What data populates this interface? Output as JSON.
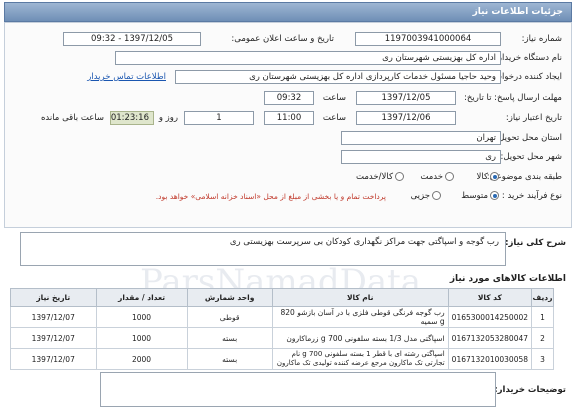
{
  "header": {
    "title": "جزئیات اطلاعات نیاز"
  },
  "form": {
    "need_number_label": "شماره نیاز:",
    "need_number": "1197003941000064",
    "announce_label": "تاریخ و ساعت اعلان عمومی:",
    "announce_value": "1397/12/05 - 09:32",
    "buyer_label": "نام دستگاه خریدار:",
    "buyer_value": "اداره کل بهزیستی شهرستان ری",
    "creator_label": "ایجاد کننده درخواست:",
    "creator_value": "وحید حاجیا مسئول خدمات کارپردازی اداره کل بهزیستی شهرستان ری",
    "contact_link": "اطلاعات تماس خریدار",
    "send_deadline_label": "مهلت ارسال پاسخ: تا تاریخ:",
    "send_date": "1397/12/05",
    "time_label": "ساعت",
    "send_time": "09:32",
    "validity_label": "تاریخ اعتبار نیاز:",
    "validity_date": "1397/12/06",
    "validity_time": "11:00",
    "days_value": "1",
    "days_label": "روز و",
    "remaining_time": "01:23:16",
    "remaining_label": "ساعت باقی مانده",
    "province_label": "استان محل تحویل:",
    "province_value": "تهران",
    "city_label": "شهر محل تحویل:",
    "city_value": "ری",
    "category_label": "طبقه بندی موضوعی:",
    "category_options": [
      "کالا",
      "خدمت",
      "کالا/خدمت"
    ],
    "purchase_label": "نوع فرآیند خرید :",
    "purchase_options": [
      "متوسط",
      "جزیی"
    ],
    "purchase_note": "پرداخت تمام و یا بخشی از مبلغ از محل «اسناد خزانه اسلامی» خواهد بود.",
    "general_desc_label": "شرح کلی نیاز:",
    "general_desc": "رب گوجه و اسپاگتی جهت مراکز نگهداری کودکان بی سرپرست بهزیستی ری"
  },
  "items_section": {
    "title": "اطلاعات کالاهای مورد نیاز",
    "columns": [
      "ردیف",
      "کد کالا",
      "نام کالا",
      "واحد شمارش",
      "تعداد / مقدار",
      "تاریخ نیاز"
    ],
    "rows": [
      {
        "row": "1",
        "code": "0165300014250002",
        "name": "رب گوجه فرنگی قوطی فلزی با در آسان بازشو 820 g سمیه",
        "unit": "قوطی",
        "qty": "1000",
        "date": "1397/12/07"
      },
      {
        "row": "2",
        "code": "0167132053280047",
        "name": "اسپاگتی مدل 1/3 بسته سلفونی 700 g زرماکارون",
        "unit": "بسته",
        "qty": "1000",
        "date": "1397/12/07"
      },
      {
        "row": "3",
        "code": "0167132010030058",
        "name": "اسپاگتی رشته ای با قطر 1 بسته سلفونی 700 g نام تجارتی تک ماکارون مرجع عرضه کننده تولیدی تک ماکارون",
        "unit": "بسته",
        "qty": "2000",
        "date": "1397/12/07"
      }
    ]
  },
  "buyer_notes": {
    "label": "توضیحات خریدار:"
  },
  "watermark": "ParsNamadData"
}
